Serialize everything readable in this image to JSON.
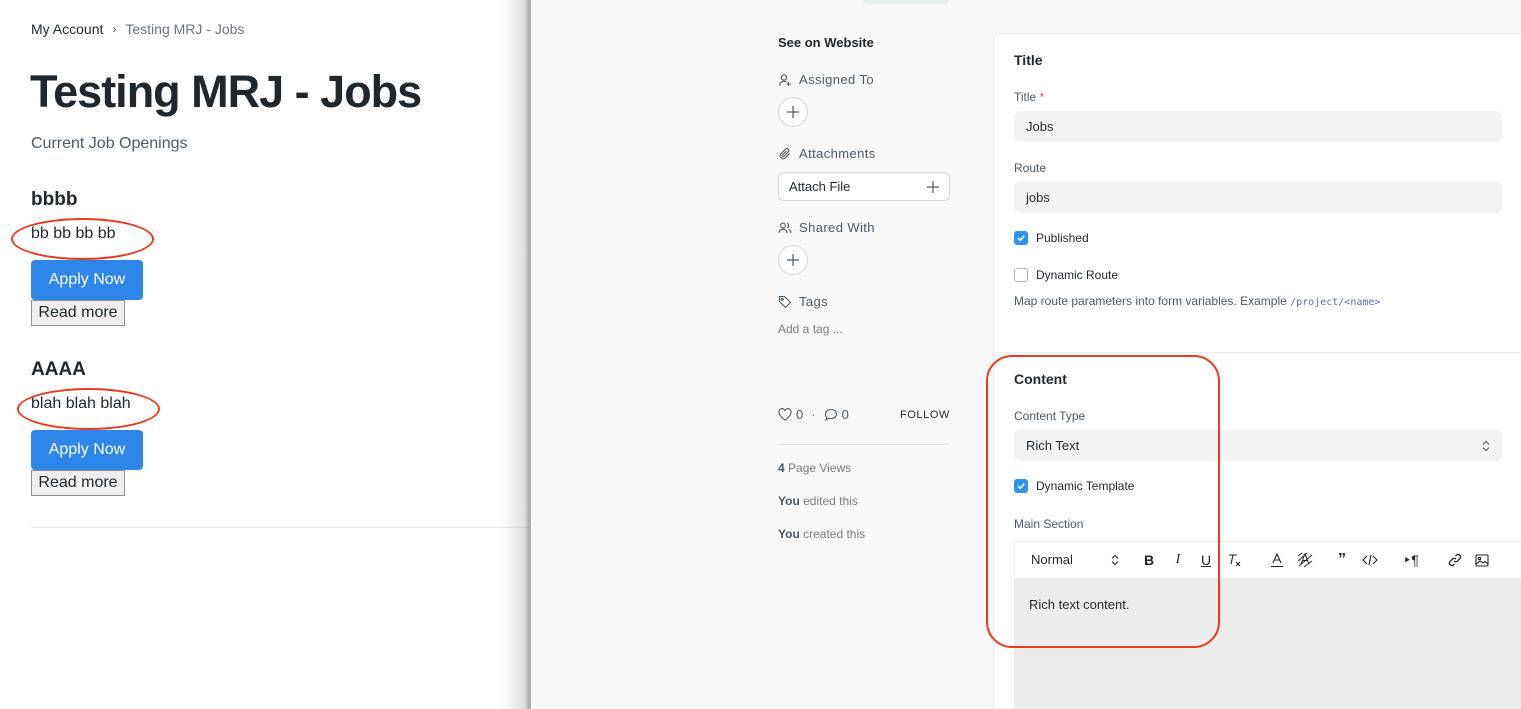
{
  "left_page": {
    "breadcrumb": {
      "home": "My Account",
      "separator": "›",
      "current": "Testing MRJ - Jobs"
    },
    "title": "Testing MRJ - Jobs",
    "subtitle": "Current Job Openings",
    "jobs": [
      {
        "title": "bbbb",
        "description": "bb bb bb bb",
        "apply_label": "Apply Now",
        "read_more_label": "Read more"
      },
      {
        "title": "AAAA",
        "description": "blah blah blah",
        "apply_label": "Apply Now",
        "read_more_label": "Read more"
      }
    ]
  },
  "sidebar": {
    "see_on_website": "See on Website",
    "assigned_to": "Assigned To",
    "attachments": "Attachments",
    "attach_file": "Attach File",
    "shared_with": "Shared With",
    "tags": "Tags",
    "add_tag": "Add a tag ...",
    "likes": "0",
    "comments": "0",
    "follow": "FOLLOW",
    "page_views_count": "4",
    "page_views_label": " Page Views",
    "edited_user": "You",
    "edited_text": " edited this",
    "created_user": "You",
    "created_text": " created this"
  },
  "form": {
    "title_section": {
      "heading": "Title",
      "title_label": "Title",
      "title_required": "*",
      "title_value": "Jobs",
      "route_label": "Route",
      "route_value": "jobs",
      "published_label": "Published",
      "published_checked": true,
      "dynamic_route_label": "Dynamic Route",
      "dynamic_route_checked": false,
      "help_text": "Map route parameters into form variables. Example ",
      "help_code": "/project/<name>"
    },
    "content_section": {
      "heading": "Content",
      "content_type_label": "Content Type",
      "content_type_value": "Rich Text",
      "dynamic_template_label": "Dynamic Template",
      "dynamic_template_checked": true,
      "main_section_label": "Main Section",
      "editor_format": "Normal",
      "editor_content": "Rich text content."
    }
  },
  "colors": {
    "primary_button": "#2e86e8",
    "checkbox_on": "#2d95f0",
    "annotation_circle": "#ea3a1e",
    "required_star": "#e24c4c"
  }
}
